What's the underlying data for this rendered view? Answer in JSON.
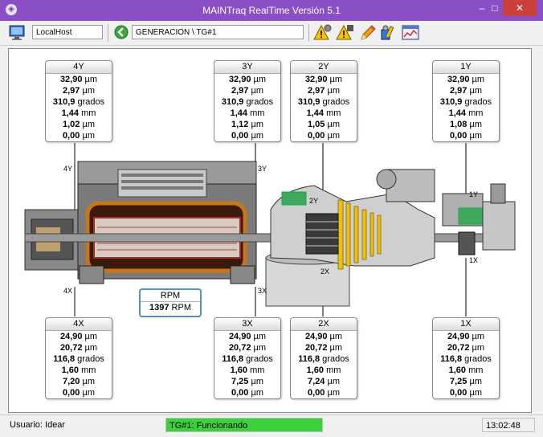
{
  "window": {
    "title": "MAINTraq RealTime Versión 5.1"
  },
  "toolbar": {
    "host": "LocalHost",
    "path": "GENERACION \\ TG#1"
  },
  "sensors": {
    "s4Y": {
      "label": "4Y",
      "r1": "32,90",
      "u1": "µm",
      "r2": "2,97",
      "u2": "µm",
      "r3": "310,9",
      "u3": "grados",
      "r4": "1,44",
      "u4": "mm",
      "r5": "1,02",
      "u5": "µm",
      "r6": "0,00",
      "u6": "µm"
    },
    "s3Y": {
      "label": "3Y",
      "r1": "32,90",
      "u1": "µm",
      "r2": "2,97",
      "u2": "µm",
      "r3": "310,9",
      "u3": "grados",
      "r4": "1,44",
      "u4": "mm",
      "r5": "1,12",
      "u5": "µm",
      "r6": "0,00",
      "u6": "µm"
    },
    "s2Y": {
      "label": "2Y",
      "r1": "32,90",
      "u1": "µm",
      "r2": "2,97",
      "u2": "µm",
      "r3": "310,9",
      "u3": "grados",
      "r4": "1,44",
      "u4": "mm",
      "r5": "1,05",
      "u5": "µm",
      "r6": "0,00",
      "u6": "µm"
    },
    "s1Y": {
      "label": "1Y",
      "r1": "32,90",
      "u1": "µm",
      "r2": "2,97",
      "u2": "µm",
      "r3": "310,9",
      "u3": "grados",
      "r4": "1,44",
      "u4": "mm",
      "r5": "1,08",
      "u5": "µm",
      "r6": "0,00",
      "u6": "µm"
    },
    "s4X": {
      "label": "4X",
      "r1": "24,90",
      "u1": "µm",
      "r2": "20,72",
      "u2": "µm",
      "r3": "116,8",
      "u3": "grados",
      "r4": "1,60",
      "u4": "mm",
      "r5": "7,20",
      "u5": "µm",
      "r6": "0,00",
      "u6": "µm"
    },
    "s3X": {
      "label": "3X",
      "r1": "24,90",
      "u1": "µm",
      "r2": "20,72",
      "u2": "µm",
      "r3": "116,8",
      "u3": "grados",
      "r4": "1,60",
      "u4": "mm",
      "r5": "7,25",
      "u5": "µm",
      "r6": "0,00",
      "u6": "µm"
    },
    "s2X": {
      "label": "2X",
      "r1": "24,90",
      "u1": "µm",
      "r2": "20,72",
      "u2": "µm",
      "r3": "116,8",
      "u3": "grados",
      "r4": "1,60",
      "u4": "mm",
      "r5": "7,24",
      "u5": "µm",
      "r6": "0,00",
      "u6": "µm"
    },
    "s1X": {
      "label": "1X",
      "r1": "24,90",
      "u1": "µm",
      "r2": "20,72",
      "u2": "µm",
      "r3": "116,8",
      "u3": "grados",
      "r4": "1,60",
      "u4": "mm",
      "r5": "7,25",
      "u5": "µm",
      "r6": "0,00",
      "u6": "µm"
    }
  },
  "probe_labels": {
    "p4Y": "4Y",
    "p3Y": "3Y",
    "p2Y": "2Y",
    "p1Y": "1Y",
    "p4X": "4X",
    "p3X": "3X",
    "p2X": "2X",
    "p1X": "1X"
  },
  "rpm": {
    "label": "RPM",
    "value": "1397",
    "unit": "RPM"
  },
  "status": {
    "user": "Usuario: Idear",
    "machine": "TG#1: Funcionando",
    "time": "13:02:48"
  },
  "colors": {
    "titlebar": "#8a4fc4",
    "status_ok": "#3bd13b",
    "copper": "#c8761a"
  },
  "icons": [
    "computer-icon",
    "back-arrow-icon",
    "warning-settings-icon",
    "warning-config-icon",
    "pencil-icon",
    "tools-icon",
    "chart-window-icon"
  ]
}
